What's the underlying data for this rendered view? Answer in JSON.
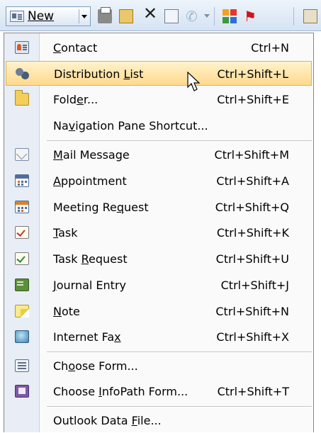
{
  "toolbar": {
    "new_label": "New",
    "icons": [
      "print-icon",
      "move-to-folder-icon",
      "delete-icon",
      "address-book-icon",
      "phone-icon",
      "categorize-icon",
      "follow-up-flag-icon",
      "book-icon"
    ]
  },
  "colors": {
    "hover_top": "#fff3cd",
    "hover_bottom": "#ffd98d",
    "hover_border": "#e3b449",
    "menu_bg": "#fafafa",
    "gutter_bg": "#e9eef6"
  },
  "menu": {
    "highlighted_item": "Distribution List",
    "items": [
      {
        "icon": "contact-card-icon",
        "pre": "",
        "ul": "C",
        "post": "ontact",
        "shortcut": "Ctrl+N"
      },
      {
        "icon": "distribution-list-icon",
        "pre": "Distribution ",
        "ul": "L",
        "post": "ist",
        "shortcut": "Ctrl+Shift+L"
      },
      {
        "icon": "folder-icon",
        "pre": "Fold",
        "ul": "e",
        "post": "r...",
        "shortcut": "Ctrl+Shift+E"
      },
      {
        "icon": "",
        "pre": "Na",
        "ul": "v",
        "post": "igation Pane Shortcut...",
        "shortcut": ""
      },
      {
        "icon": "mail-message-icon",
        "pre": "",
        "ul": "M",
        "post": "ail Message",
        "shortcut": "Ctrl+Shift+M"
      },
      {
        "icon": "appointment-calendar-icon",
        "pre": "",
        "ul": "A",
        "post": "ppointment",
        "shortcut": "Ctrl+Shift+A"
      },
      {
        "icon": "meeting-request-icon",
        "pre": "Meeting Re",
        "ul": "q",
        "post": "uest",
        "shortcut": "Ctrl+Shift+Q"
      },
      {
        "icon": "task-icon",
        "pre": "",
        "ul": "T",
        "post": "ask",
        "shortcut": "Ctrl+Shift+K"
      },
      {
        "icon": "task-request-icon",
        "pre": "Task ",
        "ul": "R",
        "post": "equest",
        "shortcut": "Ctrl+Shift+U"
      },
      {
        "icon": "journal-entry-icon",
        "pre": "",
        "ul": "J",
        "post": "ournal Entry",
        "shortcut": "Ctrl+Shift+J"
      },
      {
        "icon": "note-icon",
        "pre": "",
        "ul": "N",
        "post": "ote",
        "shortcut": "Ctrl+Shift+N"
      },
      {
        "icon": "internet-fax-icon",
        "pre": "Internet Fa",
        "ul": "x",
        "post": "",
        "shortcut": "Ctrl+Shift+X"
      },
      {
        "icon": "choose-form-icon",
        "pre": "Ch",
        "ul": "o",
        "post": "ose Form...",
        "shortcut": ""
      },
      {
        "icon": "infopath-form-icon",
        "pre": "Choose ",
        "ul": "I",
        "post": "nfoPath Form...",
        "shortcut": "Ctrl+Shift+T"
      },
      {
        "icon": "",
        "pre": "Outlook Data ",
        "ul": "F",
        "post": "ile...",
        "shortcut": ""
      }
    ]
  }
}
